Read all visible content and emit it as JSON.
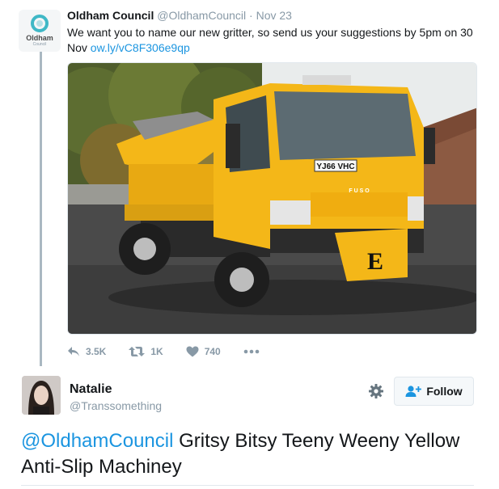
{
  "original_tweet": {
    "author_name": "Oldham Council",
    "author_handle": "@OldhamCouncil",
    "separator": " · ",
    "date": "Nov 23",
    "text_before_link": "We want you to name our new gritter, so send us your suggestions by 5pm on 30 Nov ",
    "link": "ow.ly/vC8F306e9qp",
    "avatar_logo_text": "Oldham",
    "avatar_logo_subtext": "Council",
    "media": {
      "plate": "YJ66 VHC",
      "grille_badge": "F U S O",
      "bumper_letter": "E"
    },
    "stats": {
      "replies": "3.5K",
      "retweets": "1K",
      "likes": "740"
    },
    "colors": {
      "link": "#1b95e0",
      "logo_teal": "#3fb8c6",
      "truck_yellow": "#f4b718"
    }
  },
  "reply": {
    "author_name": "Natalie",
    "author_handle": "@Transsomething",
    "follow_label": "Follow",
    "mention": "@OldhamCouncil",
    "text": " Gritsy Bitsy Teeny Weeny Yellow Anti-Slip Machiney"
  },
  "icons": {
    "reply": "reply-icon",
    "retweet": "retweet-icon",
    "like": "heart-icon",
    "more": "more-dots-icon",
    "settings": "gear-icon",
    "follow": "add-user-icon"
  }
}
